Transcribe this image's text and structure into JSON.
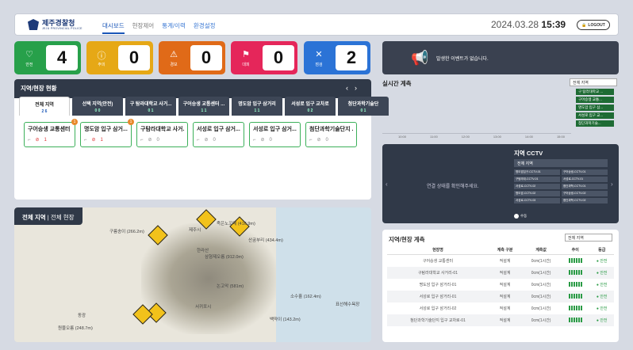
{
  "header": {
    "logo_title": "제주경찰청",
    "logo_sub": "JEJU PROVINCIAL POLICE",
    "nav": [
      "대시보드",
      "현장제어",
      "통계/이력",
      "환경설정"
    ],
    "date": "2024.03.28",
    "time": "15:39",
    "logout": "LOGOUT"
  },
  "status_cards": [
    {
      "label": "안전",
      "value": "4",
      "color": "#27a04a",
      "icon": "heart-icon"
    },
    {
      "label": "주의",
      "value": "0",
      "color": "#e6a816",
      "icon": "info-icon"
    },
    {
      "label": "경보",
      "value": "0",
      "color": "#e06a18",
      "icon": "warning-icon"
    },
    {
      "label": "대피",
      "value": "0",
      "color": "#e5265a",
      "icon": "run-icon"
    },
    {
      "label": "점검",
      "value": "2",
      "color": "#2b73d6",
      "icon": "tools-icon"
    }
  ],
  "status_panel": {
    "title": "지역/현장 현황",
    "tabs": [
      {
        "label": "전체 지역",
        "count": "2  6"
      },
      {
        "label": "선택 지역(안전)",
        "count": "0  0"
      },
      {
        "label": "구 탐라대학교 사거...",
        "count": "0  1"
      },
      {
        "label": "구어승생 교통센터 ...",
        "count": "1  1"
      },
      {
        "label": "명도암 입구 삼거리",
        "count": "1  1"
      },
      {
        "label": "서성로 입구 교차로",
        "count": "0  2"
      },
      {
        "label": "첨단과학기술단",
        "count": "0  1"
      }
    ],
    "cards": [
      {
        "name": "구어승생 교통센터",
        "a": "",
        "b": "1",
        "badge": "1"
      },
      {
        "name": "명도암 입구 삼거...",
        "a": "",
        "b": "1",
        "badge": "1"
      },
      {
        "name": "구탐라대학교 사거...",
        "a": "",
        "b": "0",
        "badge": ""
      },
      {
        "name": "서성로 입구 삼거...",
        "a": "",
        "b": "0",
        "badge": ""
      },
      {
        "name": "서성로 입구 삼거...",
        "a": "",
        "b": "0",
        "badge": ""
      },
      {
        "name": "첨단과학기술단지 ...",
        "a": "",
        "b": "0",
        "badge": ""
      }
    ]
  },
  "map": {
    "label_a": "전체 지역",
    "label_b": "전체 현장",
    "places": [
      "구름송이 (266.2m)",
      "제주시",
      "족은노꼬메 (416.9m)",
      "한라산",
      "삼형제오름 (912.0m)",
      "산굼부리 (434.4m)",
      "논고악 (581m)",
      "서귀포시",
      "소수흘 (162.4m)",
      "백약이 (143.2m)",
      "동광",
      "원물오름 (248.7m)",
      "표선해수욕장"
    ]
  },
  "alert": {
    "text": "발생한 이벤트가 없습니다."
  },
  "realtime": {
    "title": "실시간 계측",
    "select": "전체 지역",
    "legend": [
      "구 탐라대학교 ...",
      "구어승생 교통...",
      "명도암 입구 삼...",
      "서성로 입구 교...",
      "첨단과학기술..."
    ],
    "times": [
      "10:00",
      "11:00",
      "12:00",
      "13:00",
      "14:00",
      "15:00"
    ]
  },
  "cctv": {
    "title": "지역 CCTV",
    "region": "전체 지역",
    "message": "연결 상태를 확인해주세요.",
    "items": [
      "명도암입구-CCTV-01",
      "구어승생-CCTV-01",
      "구탐라대-CCTV-01",
      "서성로-CCTV-01",
      "서성로-CCTV-02",
      "첨단과학-CCTV-01",
      "명도암-CCTV-02",
      "구어승생-CCTV-02",
      "서성로-CCTV-03",
      "첨단과학-CCTV-02"
    ],
    "toggle": "수동"
  },
  "measure": {
    "title": "지역/현장 계측",
    "select": "전체 지역",
    "headers": [
      "현장명",
      "계측 구분",
      "계측값",
      "추이",
      "등급"
    ],
    "rows": [
      {
        "name": "구어승생 교통센터",
        "type": "적설계",
        "value": "0cm(1시간)",
        "grade": "안전"
      },
      {
        "name": "구탐라대학교 사거리-01",
        "type": "적설계",
        "value": "0cm(1시간)",
        "grade": "안전"
      },
      {
        "name": "명도암 입구 삼거리-01",
        "type": "적설계",
        "value": "0cm(1시간)",
        "grade": "안전"
      },
      {
        "name": "서성로 입구 삼거리-01",
        "type": "적설계",
        "value": "0cm(1시간)",
        "grade": "안전"
      },
      {
        "name": "서성로 입구 삼거리-02",
        "type": "적설계",
        "value": "0cm(1시간)",
        "grade": "안전"
      },
      {
        "name": "첨단과학기술단지 입구 교차로-01",
        "type": "적설계",
        "value": "0cm(1시간)",
        "grade": "안전"
      }
    ]
  }
}
